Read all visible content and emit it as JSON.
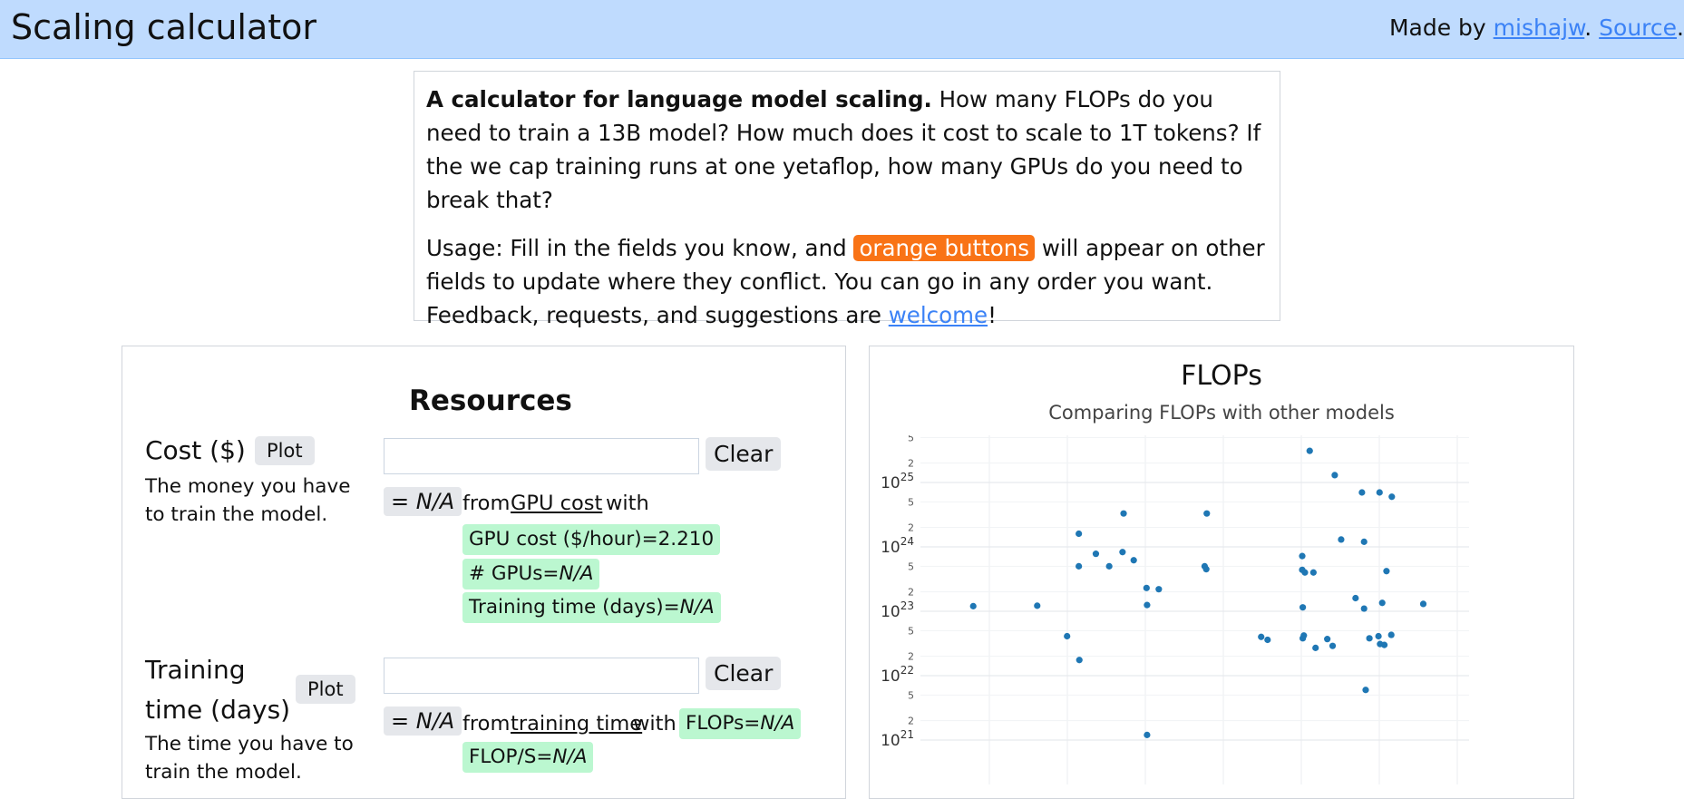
{
  "header": {
    "title": "Scaling calculator",
    "made_by_prefix": "Made by ",
    "author_link": "mishajw",
    "separator": ". ",
    "source_link": "Source",
    "suffix": "."
  },
  "intro": {
    "bold_lead": "A calculator for language model scaling.",
    "para1_rest": " How many FLOPs do you need to train a 13B model? How much does it cost to scale to 1T tokens? If the we cap training runs at one yetaflop, how many GPUs do you need to break that?",
    "usage_prefix": "Usage: Fill in the fields you know, and ",
    "orange_label": "orange buttons",
    "usage_mid": " will appear on other fields to update where they conflict. You can go in any order you want. Feedback, requests, and suggestions are ",
    "welcome_link": "welcome",
    "usage_end": "!"
  },
  "resources": {
    "title": "Resources",
    "cost": {
      "label": "Cost ($)",
      "plot_label": "Plot",
      "desc_line1": "The money you have",
      "desc_line2": "to train the model.",
      "input_value": "",
      "clear_label": "Clear",
      "eq_prefix": "= ",
      "eq_value": "N/A",
      "from_text": "from",
      "formula_link": "GPU cost",
      "with_text": "with",
      "params": [
        {
          "name": "GPU cost ($/hour)=",
          "value": "2.210"
        },
        {
          "name": "# GPUs=",
          "value": "N/A"
        },
        {
          "name": "Training time (days)=",
          "value": "N/A"
        }
      ]
    },
    "training_time": {
      "label_line1": "Training",
      "label_line2": "time (days)",
      "plot_label": "Plot",
      "desc_line1": "The time you have to",
      "desc_line2": "train the model.",
      "input_value": "",
      "clear_label": "Clear",
      "eq_prefix": "= ",
      "eq_value": "N/A",
      "from_text": "from",
      "formula_link": "training time",
      "with_text": "with",
      "params": [
        {
          "name": "FLOPs=",
          "value": "N/A"
        },
        {
          "name": "FLOP/S=",
          "value": "N/A"
        }
      ]
    }
  },
  "chart": {
    "title": "FLOPs",
    "subtitle": "Comparing FLOPs with other models",
    "color": "#1f77b4"
  },
  "chart_data": {
    "type": "scatter",
    "title": "FLOPs",
    "subtitle": "Comparing FLOPs with other models",
    "yscale": "log",
    "ytick_labels": [
      "10^21",
      "10^22",
      "10^23",
      "10^24",
      "10^25"
    ],
    "minor_tick_labels": [
      "2",
      "5"
    ],
    "grid": true,
    "series": [
      {
        "x": [
          82,
          202,
          258,
          280,
          280,
          281,
          312,
          337,
          362,
          364,
          383,
          407,
          408,
          408,
          430,
          516,
          519,
          520,
          622,
          634,
          699,
          699,
          700,
          700,
          702,
          704,
          713,
          720,
          724,
          746,
          756,
          760,
          772,
          799,
          811,
          815,
          815,
          818,
          825,
          842,
          844,
          845,
          849,
          853,
          857,
          866,
          867,
          926
        ],
        "y": [
          1.2e+23,
          1.22e+23,
          4.1e+22,
          1.6e+24,
          5e+23,
          1.75e+22,
          7.8e+23,
          5e+23,
          8.3e+23,
          3.3e+24,
          6.2e+23,
          2.3e+23,
          1.25e+23,
          1.2e+21,
          2.2e+23,
          5e+23,
          4.5e+23,
          3.3e+24,
          4e+22,
          3.6e+22,
          7.2e+23,
          4.4e+23,
          1.15e+23,
          3.8e+22,
          4.2e+22,
          4e+23,
          3.1e+25,
          4e+23,
          2.7e+22,
          3.7e+22,
          2.9e+22,
          1.3e+25,
          1.3e+24,
          1.6e+23,
          7e+24,
          1.2e+24,
          1.1e+23,
          6e+21,
          3.8e+22,
          4.1e+22,
          7e+24,
          3.1e+22,
          1.35e+23,
          3e+22,
          4.2e+23,
          4.3e+22,
          6e+24,
          1.3e+23
        ]
      }
    ]
  }
}
